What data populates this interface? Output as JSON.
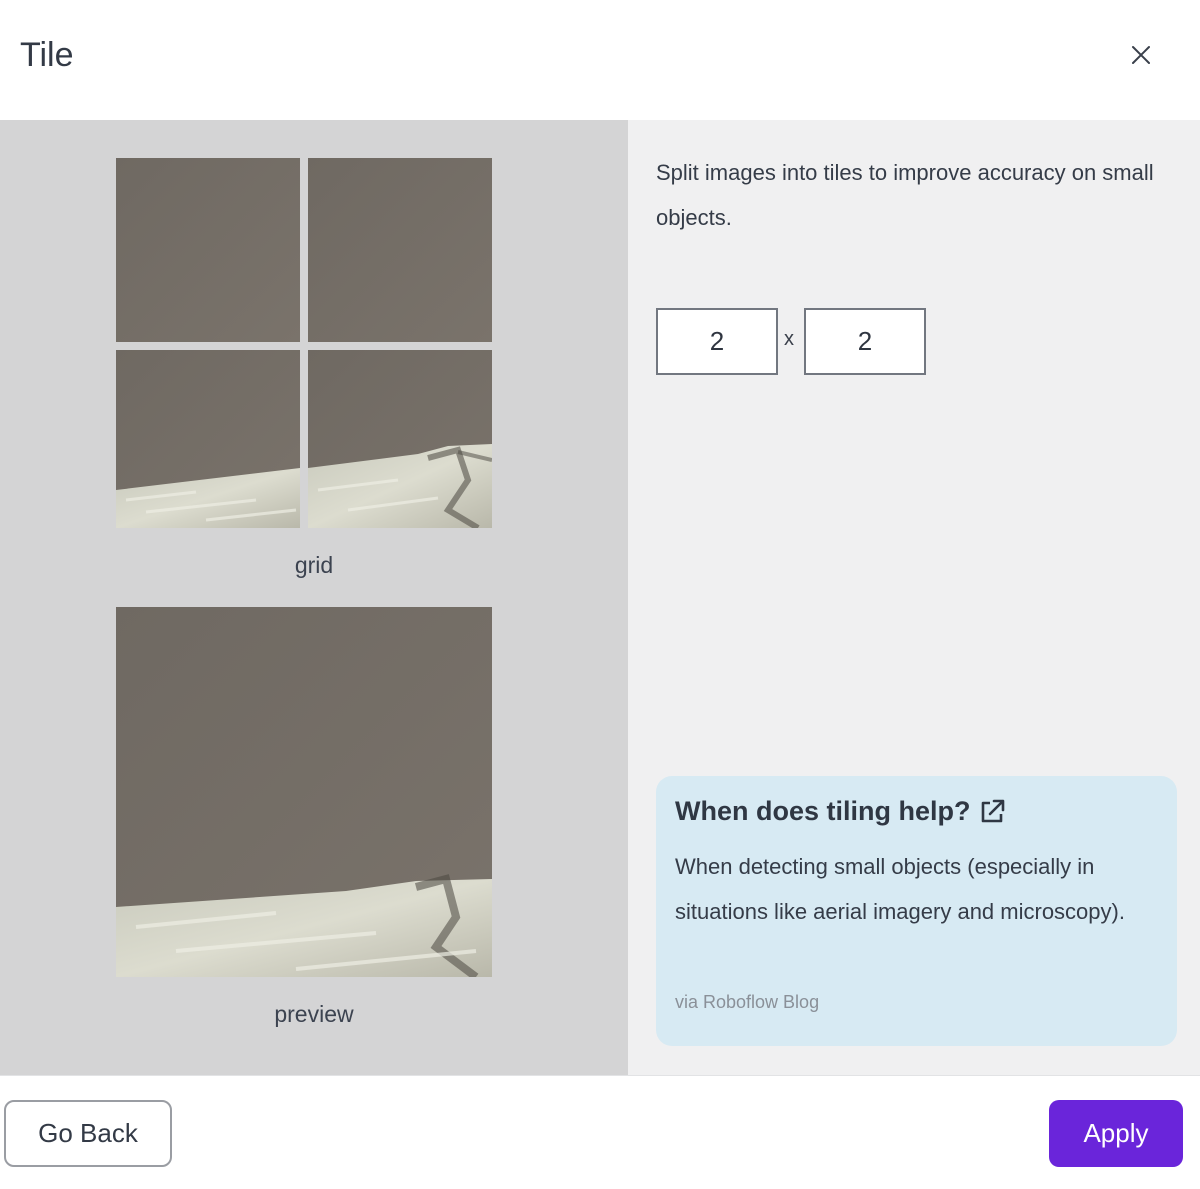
{
  "dialog": {
    "title": "Tile",
    "close_icon": "close-icon"
  },
  "preview": {
    "grid_caption": "grid",
    "preview_caption": "preview"
  },
  "settings": {
    "description": "Split images into tiles to improve accuracy on small objects.",
    "columns": "2",
    "times_symbol": "x",
    "rows": "2"
  },
  "info": {
    "title": "When does tiling help?",
    "link_icon": "external-link-icon",
    "body": "When detecting small objects (especially in situations like aerial imagery and microscopy).",
    "source": "via Roboflow Blog",
    "background": "#d7eaf3"
  },
  "footer": {
    "back_label": "Go Back",
    "apply_label": "Apply",
    "accent": "#6a25da"
  }
}
